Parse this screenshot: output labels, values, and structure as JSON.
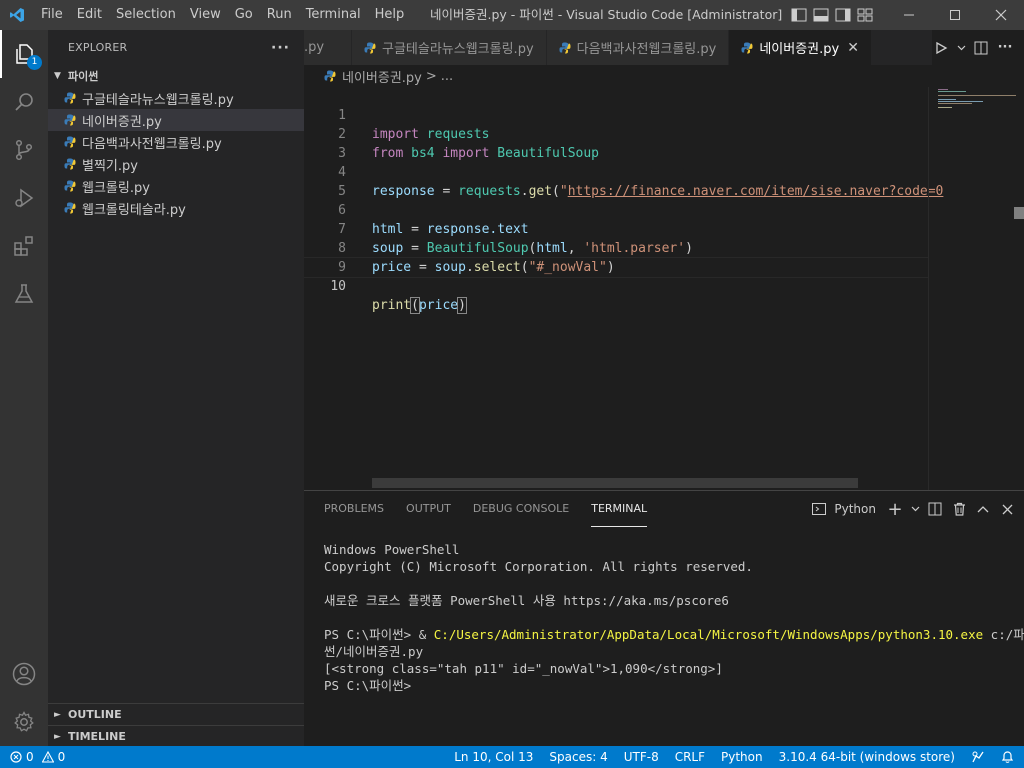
{
  "window": {
    "title": "네이버증권.py - 파이썬 - Visual Studio Code [Administrator]",
    "menu": [
      "File",
      "Edit",
      "Selection",
      "View",
      "Go",
      "Run",
      "Terminal",
      "Help"
    ]
  },
  "activity_bar": {
    "explorer_badge": "1"
  },
  "sidebar": {
    "title": "EXPLORER",
    "more": "···",
    "folder": "파이썬",
    "files": [
      {
        "name": "구글테슬라뉴스웹크롤링.py",
        "selected": false
      },
      {
        "name": "네이버증권.py",
        "selected": true
      },
      {
        "name": "다음백과사전웹크롤링.py",
        "selected": false
      },
      {
        "name": "별찍기.py",
        "selected": false
      },
      {
        "name": "웹크롤링.py",
        "selected": false
      },
      {
        "name": "웹크롤링테슬라.py",
        "selected": false
      }
    ],
    "outline": "OUTLINE",
    "timeline": "TIMELINE"
  },
  "tabs": [
    {
      "label": ".py",
      "active": false
    },
    {
      "label": "구글테슬라뉴스웹크롤링.py",
      "active": false
    },
    {
      "label": "다음백과사전웹크롤링.py",
      "active": false
    },
    {
      "label": "네이버증권.py",
      "active": true
    }
  ],
  "breadcrumb": {
    "file": "네이버증권.py",
    "sep": ">",
    "rest": "..."
  },
  "editor": {
    "current_line": 10,
    "line_numbers": [
      "1",
      "2",
      "3",
      "4",
      "5",
      "6",
      "7",
      "8",
      "9",
      "10"
    ],
    "code": {
      "l1_kw": "import",
      "l1_mod": "requests",
      "l2_kw1": "from",
      "l2_mod": "bs4",
      "l2_kw2": "import",
      "l2_cls": "BeautifulSoup",
      "l4_var": "response",
      "l4_eq": " = ",
      "l4_mod": "requests",
      "l4_dot": ".",
      "l4_fn": "get",
      "l4_open": "(",
      "l4_q": "\"",
      "l4_url": "https://finance.naver.com/item/sise.naver?code=0",
      "l6_var": "html",
      "l6_eq": " = ",
      "l6_obj": "response",
      "l6_attr": ".text",
      "l7_var": "soup",
      "l7_eq": " = ",
      "l7_cls": "BeautifulSoup",
      "l7_open": "(",
      "l7_arg": "html",
      "l7_comma": ", ",
      "l7_str": "'html.parser'",
      "l7_close": ")",
      "l8_var": "price",
      "l8_eq": " = ",
      "l8_obj": "soup",
      "l8_dot": ".",
      "l8_fn": "select",
      "l8_open": "(",
      "l8_str": "\"#_nowVal\"",
      "l8_close": ")",
      "l10_fn": "print",
      "l10_open": "(",
      "l10_arg": "price",
      "l10_close": ")"
    }
  },
  "panel": {
    "tabs": [
      {
        "label": "PROBLEMS",
        "active": false
      },
      {
        "label": "OUTPUT",
        "active": false
      },
      {
        "label": "DEBUG CONSOLE",
        "active": false
      },
      {
        "label": "TERMINAL",
        "active": true
      }
    ],
    "terminal_profile": "Python",
    "terminal": {
      "l1": "Windows PowerShell",
      "l2": "Copyright (C) Microsoft Corporation. All rights reserved.",
      "l3": "새로운 크로스 플랫폼 PowerShell 사용 https://aka.ms/pscore6",
      "l4_prompt": "PS C:\\파이썬> & ",
      "l4_path": "C:/Users/Administrator/AppData/Local/Microsoft/WindowsApps/python3.10.exe",
      "l4_arg": " c:/파이",
      "l5": "썬/네이버증권.py",
      "l6": "[<strong class=\"tah p11\" id=\"_nowVal\">1,090</strong>]",
      "l7": "PS C:\\파이썬>"
    }
  },
  "statusbar": {
    "errors": "0",
    "warnings": "0",
    "position": "Ln 10, Col 13",
    "spaces": "Spaces: 4",
    "encoding": "UTF-8",
    "eol": "CRLF",
    "language": "Python",
    "interpreter": "3.10.4 64-bit (windows store)"
  },
  "colors": {
    "accent": "#007acc",
    "titlebar": "#3c3c3c",
    "activitybar": "#333333",
    "sidebar": "#252526",
    "editor": "#1e1e1e"
  }
}
